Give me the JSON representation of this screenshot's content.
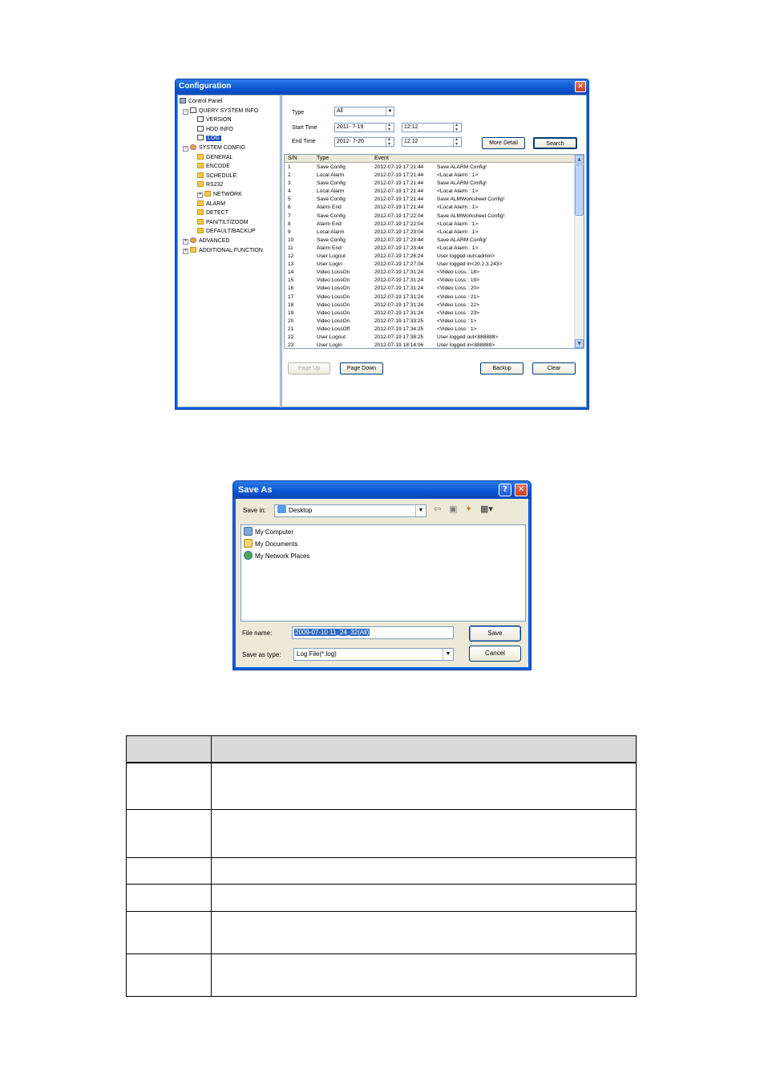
{
  "config": {
    "title": "Configuration",
    "close_glyph": "✕",
    "tree": [
      {
        "label": "Control Panel",
        "icon": "pc",
        "level": 0,
        "expander": ""
      },
      {
        "label": "QUERY SYSTEM INFO",
        "icon": "doc",
        "level": 1,
        "expander": "−"
      },
      {
        "label": "VERSION",
        "icon": "doc",
        "level": 2,
        "expander": ""
      },
      {
        "label": "HDD INFO",
        "icon": "doc",
        "level": 2,
        "expander": ""
      },
      {
        "label": "LOG",
        "icon": "doc",
        "level": 2,
        "expander": "",
        "selected": true
      },
      {
        "label": "SYSTEM CONFIG",
        "icon": "gear",
        "level": 1,
        "expander": "−"
      },
      {
        "label": "GENERAL",
        "icon": "folder",
        "level": 2,
        "expander": ""
      },
      {
        "label": "ENCODE",
        "icon": "folder",
        "level": 2,
        "expander": ""
      },
      {
        "label": "SCHEDULE",
        "icon": "folder",
        "level": 2,
        "expander": ""
      },
      {
        "label": "RS232",
        "icon": "folder",
        "level": 2,
        "expander": ""
      },
      {
        "label": "NETWORK",
        "icon": "folder",
        "level": 2,
        "expander": "+"
      },
      {
        "label": "ALARM",
        "icon": "folder",
        "level": 2,
        "expander": ""
      },
      {
        "label": "DETECT",
        "icon": "folder",
        "level": 2,
        "expander": ""
      },
      {
        "label": "PAN/TILT/ZOOM",
        "icon": "folder",
        "level": 2,
        "expander": ""
      },
      {
        "label": "DEFAULT/BACKUP",
        "icon": "folder",
        "level": 2,
        "expander": ""
      },
      {
        "label": "ADVANCED",
        "icon": "gear",
        "level": 1,
        "expander": "+"
      },
      {
        "label": "ADDITIONAL FUNCTION",
        "icon": "folder",
        "level": 1,
        "expander": "+"
      }
    ],
    "filter": {
      "type_label": "Type",
      "type_value": "All",
      "start_label": "Start Time",
      "start_date": "2011- 7-19",
      "start_time": "12:12",
      "end_label": "End Time",
      "end_date": "2012- 7-20",
      "end_time": "12:12",
      "more_detail": "More Detail",
      "search": "Search"
    },
    "log_columns": [
      "S/N",
      "Type",
      "Event"
    ],
    "log_rows": [
      [
        "1",
        "Save Config",
        "2012-07-19 17:21:44",
        "Save ALARM Config!"
      ],
      [
        "2",
        "Local Alarm",
        "2012-07-19 17:21:44",
        "<Local Alarm : 1>"
      ],
      [
        "3",
        "Save Config",
        "2012-07-19 17:21:44",
        "Save ALARM Config!"
      ],
      [
        "4",
        "Local Alarm",
        "2012-07-19 17:21:44",
        "<Local Alarm : 1>"
      ],
      [
        "5",
        "Save Config",
        "2012-07-19 17:21:44",
        "Save ALMWorksheet Config!"
      ],
      [
        "6",
        "Alarm End",
        "2012-07-19 17:21:44",
        "<Local Alarm : 1>"
      ],
      [
        "7",
        "Save Config",
        "2012-07-19 17:22:04",
        "Save ALMWorksheet Config!"
      ],
      [
        "8",
        "Alarm End",
        "2012-07-19 17:22:04",
        "<Local Alarm : 1>"
      ],
      [
        "9",
        "Local Alarm",
        "2012-07-19 17:23:04",
        "<Local Alarm : 1>"
      ],
      [
        "10",
        "Save Config",
        "2012-07-19 17:23:44",
        "Save ALARM Config!"
      ],
      [
        "11",
        "Alarm End",
        "2012-07-19 17:23:44",
        "<Local Alarm : 1>"
      ],
      [
        "12",
        "User Logout",
        "2012-07-19 17:26:24",
        "User logged out<admin>"
      ],
      [
        "13",
        "User Login",
        "2012-07-19 17:27:04",
        "User logged in<20.2.3.243>"
      ],
      [
        "14",
        "Video LossOn",
        "2012-07-19 17:31:24",
        "<Video Loss : 18>"
      ],
      [
        "15",
        "Video LossOn",
        "2012-07-19 17:31:24",
        "<Video Loss : 19>"
      ],
      [
        "16",
        "Video LossOn",
        "2012-07-19 17:31:24",
        "<Video Loss : 20>"
      ],
      [
        "17",
        "Video LossOn",
        "2012-07-19 17:31:24",
        "<Video Loss : 21>"
      ],
      [
        "18",
        "Video LossOn",
        "2012-07-19 17:31:24",
        "<Video Loss : 22>"
      ],
      [
        "19",
        "Video LossOn",
        "2012-07-19 17:31:24",
        "<Video Loss : 23>"
      ],
      [
        "20",
        "Video LossOn",
        "2012-07-19 17:33:25",
        "<Video Loss : 1>"
      ],
      [
        "21",
        "Video LossOff",
        "2012-07-19 17:34:25",
        "<Video Loss : 1>"
      ],
      [
        "22",
        "User Logout",
        "2012-07-19 17:38:25",
        "User logged out<888888>"
      ],
      [
        "23",
        "User Login",
        "2012-07-19 18:14:06",
        "User logged in<888888>"
      ]
    ],
    "buttons": {
      "page_up": "Page Up",
      "page_down": "Page Down",
      "backup": "Backup",
      "clear": "Clear"
    }
  },
  "save_as": {
    "title": "Save As",
    "help_glyph": "?",
    "close_glyph": "✕",
    "save_in_label": "Save in:",
    "save_in_value": "Desktop",
    "items": [
      "My Computer",
      "My Documents",
      "My Network Places"
    ],
    "file_name_label": "File name:",
    "file_name_value": "2009-07-10 11_24_32(All)",
    "save_type_label": "Save as type:",
    "save_type_value": "Log File(*.log)",
    "save_button": "Save",
    "cancel_button": "Cancel"
  },
  "table": {
    "rows": 6
  }
}
